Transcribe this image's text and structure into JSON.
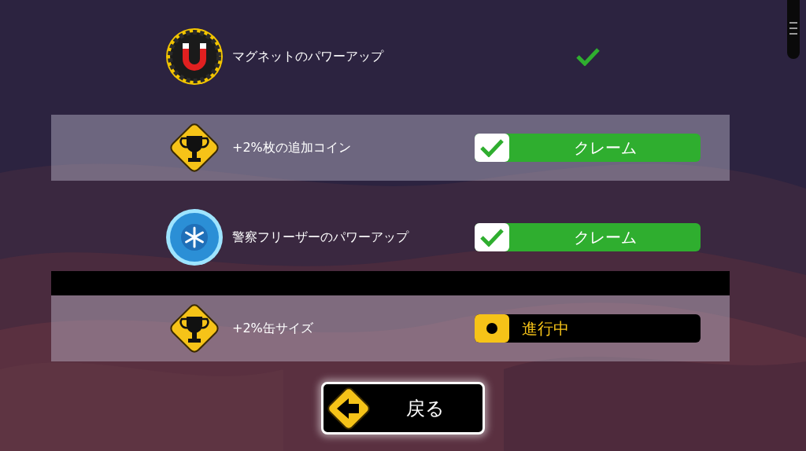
{
  "rows": [
    {
      "kind": "magnet",
      "label": "マグネットのパワーアップ",
      "highlighted": false,
      "claimed": true
    },
    {
      "kind": "trophy",
      "label": "+2%枚の追加コイン",
      "highlighted": true,
      "claimed": false,
      "in_progress": false,
      "button": "クレーム"
    },
    {
      "kind": "freeze",
      "label": "警察フリーザーのパワーアップ",
      "highlighted": false,
      "claimed": false,
      "in_progress": false,
      "button": "クレーム"
    },
    {
      "kind": "trophy",
      "label": "+2%缶サイズ",
      "highlighted": true,
      "claimed": false,
      "in_progress": true,
      "button": "進行中"
    }
  ],
  "back_button": {
    "label": "戻る"
  }
}
